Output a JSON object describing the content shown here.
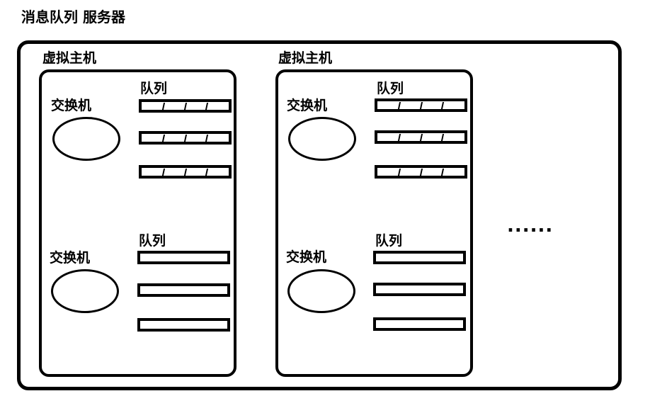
{
  "title": "消息队列 服务器",
  "ellipsis": "......",
  "vhosts": [
    {
      "label": "虚拟主机",
      "exchanges": [
        {
          "label": "交换机",
          "queue_label": "队列",
          "queues": [
            {
              "messages": 3
            },
            {
              "messages": 3
            },
            {
              "messages": 3
            }
          ]
        },
        {
          "label": "交换机",
          "queue_label": "队列",
          "queues": [
            {
              "messages": 0
            },
            {
              "messages": 0
            },
            {
              "messages": 0
            }
          ]
        }
      ]
    },
    {
      "label": "虚拟主机",
      "exchanges": [
        {
          "label": "交换机",
          "queue_label": "队列",
          "queues": [
            {
              "messages": 3
            },
            {
              "messages": 3
            },
            {
              "messages": 3
            }
          ]
        },
        {
          "label": "交换机",
          "queue_label": "队列",
          "queues": [
            {
              "messages": 0
            },
            {
              "messages": 0
            },
            {
              "messages": 0
            }
          ]
        }
      ]
    }
  ]
}
